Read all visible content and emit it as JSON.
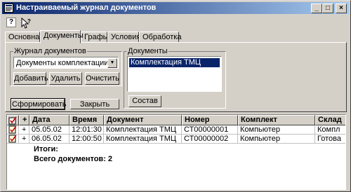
{
  "window": {
    "title": "Настраиваемый журнал документов"
  },
  "toolbar": {
    "help_label": "?"
  },
  "tabs": [
    {
      "label": "Основная"
    },
    {
      "label": "Документы"
    },
    {
      "label": "Графы"
    },
    {
      "label": "Условия"
    },
    {
      "label": "Обработка"
    }
  ],
  "journal": {
    "group_label": "Журнал документов",
    "selected": "Документы комплектации",
    "add_label": "Добавить",
    "delete_label": "Удалить",
    "clear_label": "Очистить"
  },
  "documents": {
    "group_label": "Документы",
    "items": [
      "Комплектация ТМЦ"
    ],
    "composition_label": "Состав"
  },
  "actions": {
    "form_label": "Сформировать",
    "close_label": "Закрыть"
  },
  "table": {
    "columns": [
      "",
      "+",
      "Дата",
      "Время",
      "Документ",
      "Номер",
      "Комплект",
      "Склад"
    ],
    "rows": [
      {
        "mark": "+",
        "date": "05.05.02",
        "time": "12:01:30",
        "doc": "Комплектация ТМЦ",
        "number": "СТ00000001",
        "kit": "Компьютер",
        "store": "Компл"
      },
      {
        "mark": "+",
        "date": "06.05.02",
        "time": "12:00:50",
        "doc": "Комплектация ТМЦ",
        "number": "СТ00000002",
        "kit": "Компьютер",
        "store": "Готова"
      }
    ],
    "totals_label": "Итоги:",
    "count_label": "Всего документов: 2"
  }
}
